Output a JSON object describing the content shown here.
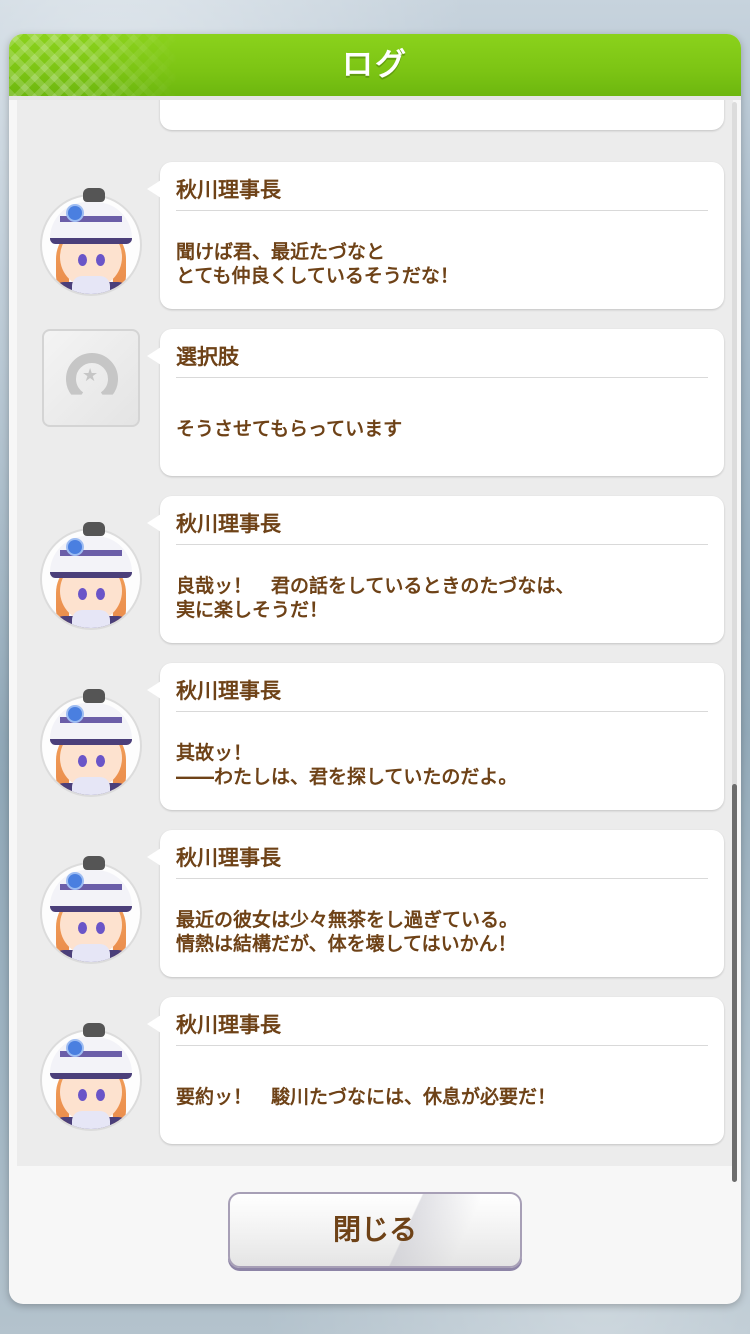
{
  "header": {
    "title": "ログ"
  },
  "log": {
    "partial_top": "",
    "entries": [
      {
        "type": "character",
        "speaker": "秋川理事長",
        "message": "聞けば君、最近たづなと\nとても仲良くしているそうだな！"
      },
      {
        "type": "choice",
        "speaker": "選択肢",
        "message": "そうさせてもらっています"
      },
      {
        "type": "character",
        "speaker": "秋川理事長",
        "message": "良哉ッ！　君の話をしているときのたづなは、\n実に楽しそうだ！"
      },
      {
        "type": "character",
        "speaker": "秋川理事長",
        "message": "其故ッ！\n――わたしは、君を探していたのだよ。"
      },
      {
        "type": "character",
        "speaker": "秋川理事長",
        "message": "最近の彼女は少々無茶をし過ぎている。\n情熱は結構だが、体を壊してはいかん！"
      },
      {
        "type": "character",
        "speaker": "秋川理事長",
        "message": "要約ッ！　駿川たづなには、休息が必要だ！"
      }
    ]
  },
  "footer": {
    "close_label": "閉じる"
  },
  "colors": {
    "header_green": "#7cc414",
    "text_brown": "#6e4217"
  },
  "icons": {
    "choice": "horseshoe-star-icon",
    "avatar": "character-portrait"
  }
}
